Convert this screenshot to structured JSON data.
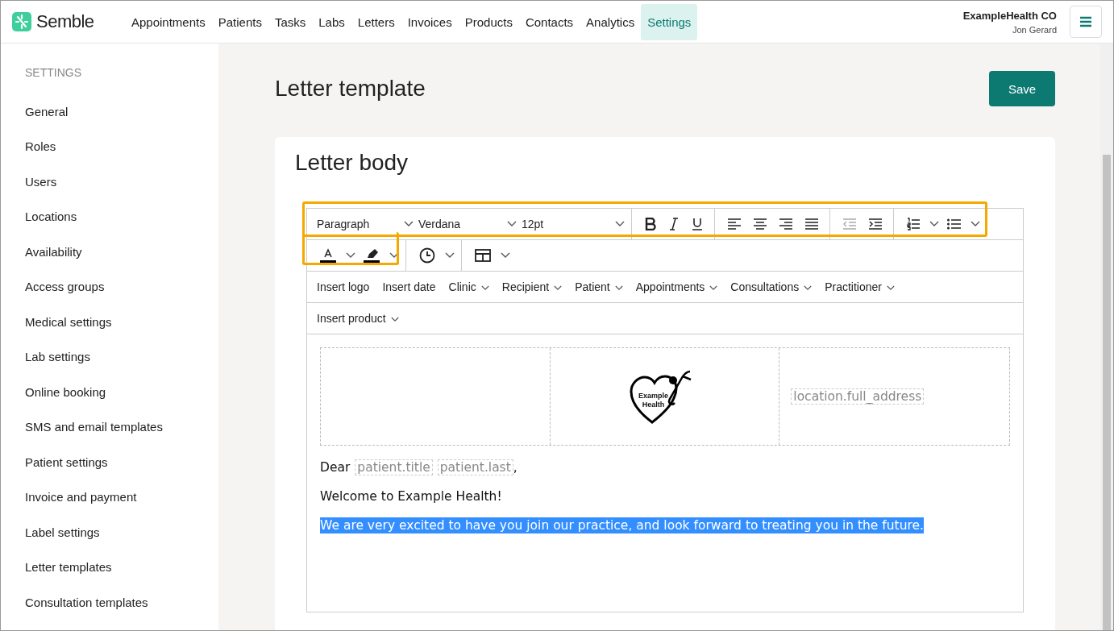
{
  "brand": {
    "name": "Semble"
  },
  "nav": [
    {
      "label": "Appointments",
      "selected": false
    },
    {
      "label": "Patients",
      "selected": false
    },
    {
      "label": "Tasks",
      "selected": false
    },
    {
      "label": "Labs",
      "selected": false
    },
    {
      "label": "Letters",
      "selected": false
    },
    {
      "label": "Invoices",
      "selected": false
    },
    {
      "label": "Products",
      "selected": false
    },
    {
      "label": "Contacts",
      "selected": false
    },
    {
      "label": "Analytics",
      "selected": false
    },
    {
      "label": "Settings",
      "selected": true
    }
  ],
  "account": {
    "org": "ExampleHealth CO",
    "user": "Jon Gerard"
  },
  "sidebar": {
    "heading": "SETTINGS",
    "items": [
      {
        "label": "General"
      },
      {
        "label": "Roles"
      },
      {
        "label": "Users"
      },
      {
        "label": "Locations"
      },
      {
        "label": "Availability"
      },
      {
        "label": "Access groups"
      },
      {
        "label": "Medical settings"
      },
      {
        "label": "Lab settings"
      },
      {
        "label": "Online booking"
      },
      {
        "label": "SMS and email templates"
      },
      {
        "label": "Patient settings"
      },
      {
        "label": "Invoice and payment"
      },
      {
        "label": "Label settings"
      },
      {
        "label": "Letter templates"
      },
      {
        "label": "Consultation templates"
      }
    ]
  },
  "page": {
    "title": "Letter template",
    "save_button": "Save"
  },
  "card": {
    "title": "Letter body"
  },
  "editor": {
    "block_format": "Paragraph",
    "font": "Verdana",
    "font_size": "12pt",
    "indent_buttons": [
      {
        "kind": "outdent",
        "disabled": true
      },
      {
        "kind": "indent",
        "disabled": false
      }
    ],
    "insert_menu": [
      {
        "label": "Insert logo",
        "dropdown": false
      },
      {
        "label": "Insert date",
        "dropdown": false
      },
      {
        "label": "Clinic",
        "dropdown": true
      },
      {
        "label": "Recipient",
        "dropdown": true
      },
      {
        "label": "Patient",
        "dropdown": true
      },
      {
        "label": "Appointments",
        "dropdown": true
      },
      {
        "label": "Consultations",
        "dropdown": true
      },
      {
        "label": "Practitioner",
        "dropdown": true
      }
    ],
    "insert_menu_2": [
      {
        "label": "Insert product",
        "dropdown": true
      }
    ],
    "logo_text": [
      "Example",
      "Health"
    ],
    "address_field": "location.full_address",
    "greeting": {
      "text": "Dear",
      "fields": [
        "patient.title",
        "patient.last"
      ],
      "end": ","
    },
    "paragraphs": [
      {
        "text": "Welcome to Example Health!",
        "selected": false
      },
      {
        "text": "We are very excited to have you join our practice, and look forward to treating you in the future.",
        "selected": true
      }
    ]
  }
}
